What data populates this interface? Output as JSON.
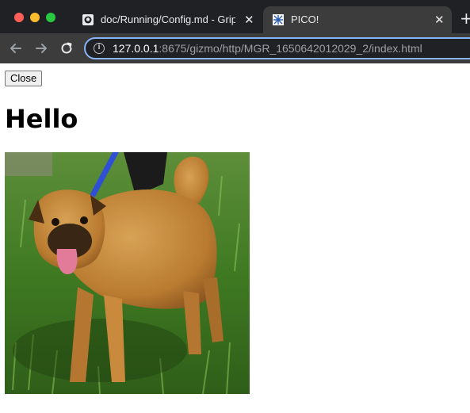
{
  "browser": {
    "tabs": [
      {
        "title": "doc/Running/Config.md - Grip",
        "favicon": "github-icon",
        "active": false
      },
      {
        "title": "PICO!",
        "favicon": "pico-icon",
        "active": true
      }
    ],
    "close_tab_glyph": "✕",
    "new_tab_glyph": "+",
    "url_host": "127.0.0.1",
    "url_rest": ":8675/gizmo/http/MGR_1650642012029_2/index.html"
  },
  "page": {
    "close_button": "Close",
    "heading": "Hello",
    "image_icon": "dog-photo"
  },
  "colors": {
    "chrome_dark": "#202124",
    "chrome": "#3c3c3c",
    "focus_ring": "#8ab4f8"
  }
}
